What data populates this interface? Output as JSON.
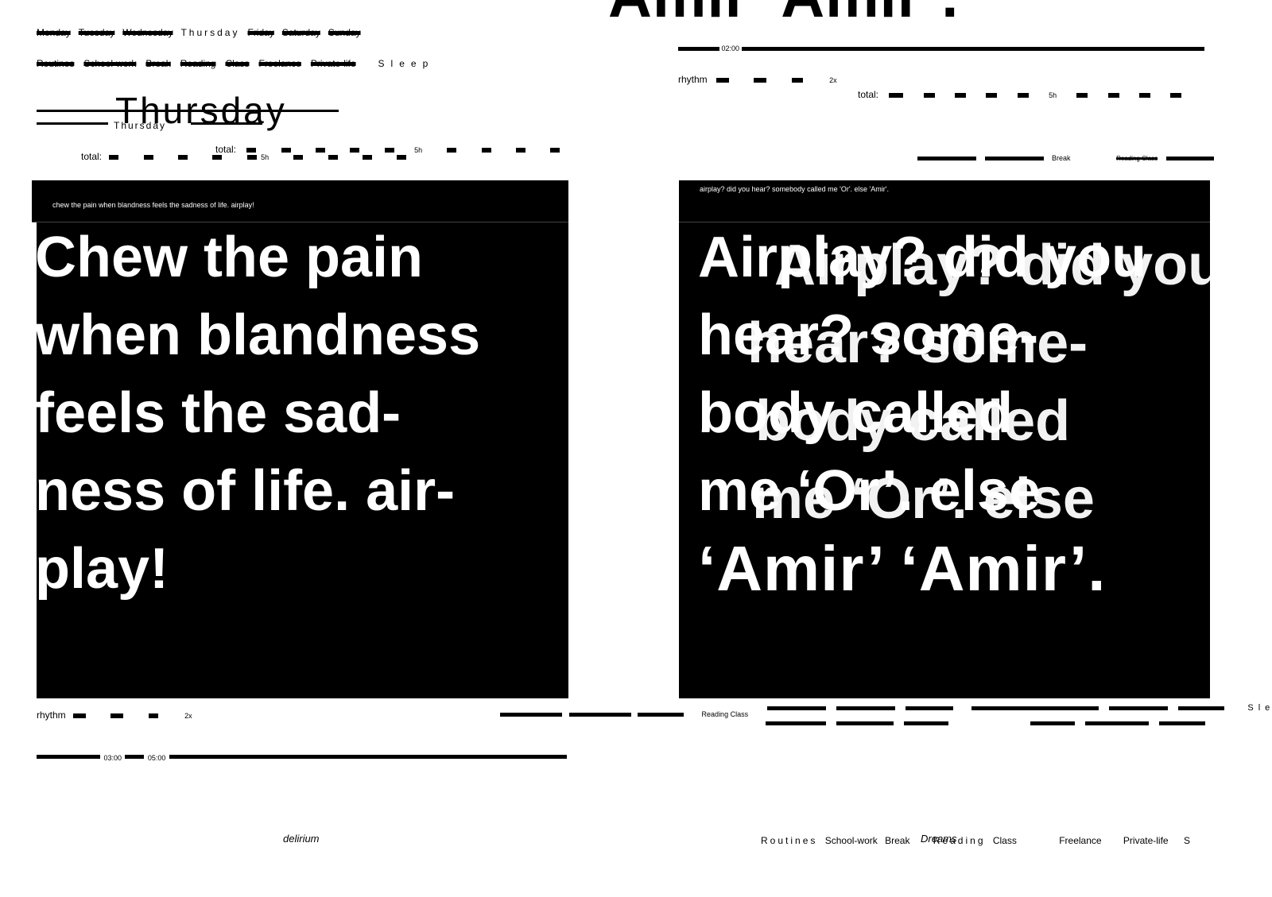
{
  "top_headline": "Amir’ Amir’.",
  "days_row_top": {
    "redacted_before": [
      "Monday",
      "Tuesday",
      "Wednesday"
    ],
    "visible": "Thursday",
    "redacted_after": [
      "Friday",
      "Saturday",
      "Sunday"
    ]
  },
  "categories_row_top": {
    "redacted": [
      "Routines",
      "School-work",
      "Break",
      "Reading",
      "Class",
      "Freelance",
      "Private-life"
    ],
    "visible": "Sleep"
  },
  "thursday_title": "Thursday",
  "thursday_small": "Thursday",
  "total_label": "total:",
  "total_marker": "5h",
  "right_time": "02:00",
  "rhythm_label": "rhythm",
  "rhythm_marker": "2x",
  "right_break_label": "Break",
  "right_reading_label": "Reading Class",
  "left_box": {
    "caption": "chew the pain when blandness feels the sadness of life. airplay!",
    "lines": [
      "Chew the pain",
      "when blandness",
      "feels the sad-",
      "ness of life. air-",
      "play!"
    ]
  },
  "right_box": {
    "caption": "airplay? did you hear? somebody called me 'Or'. else 'Amir'.",
    "lines": [
      "Airplay? did you",
      "hear? some-",
      "body called",
      "me ‘Or’. else",
      "‘Amir’ ‘Amir’."
    ]
  },
  "bottom_rhythm_label": "rhythm",
  "bottom_rhythm_marker": "2x",
  "bottom_times": [
    "03:00",
    "05:00"
  ],
  "bottom_reading_label": "Reading Class",
  "bottom_sleep": "Sleep",
  "footer_left": "delirium",
  "footer_dreams": "Dreams",
  "footer_categories": [
    "Routines",
    "School-work",
    "Break",
    "Reading",
    "Class",
    "Freelance",
    "Private-life",
    "S"
  ]
}
